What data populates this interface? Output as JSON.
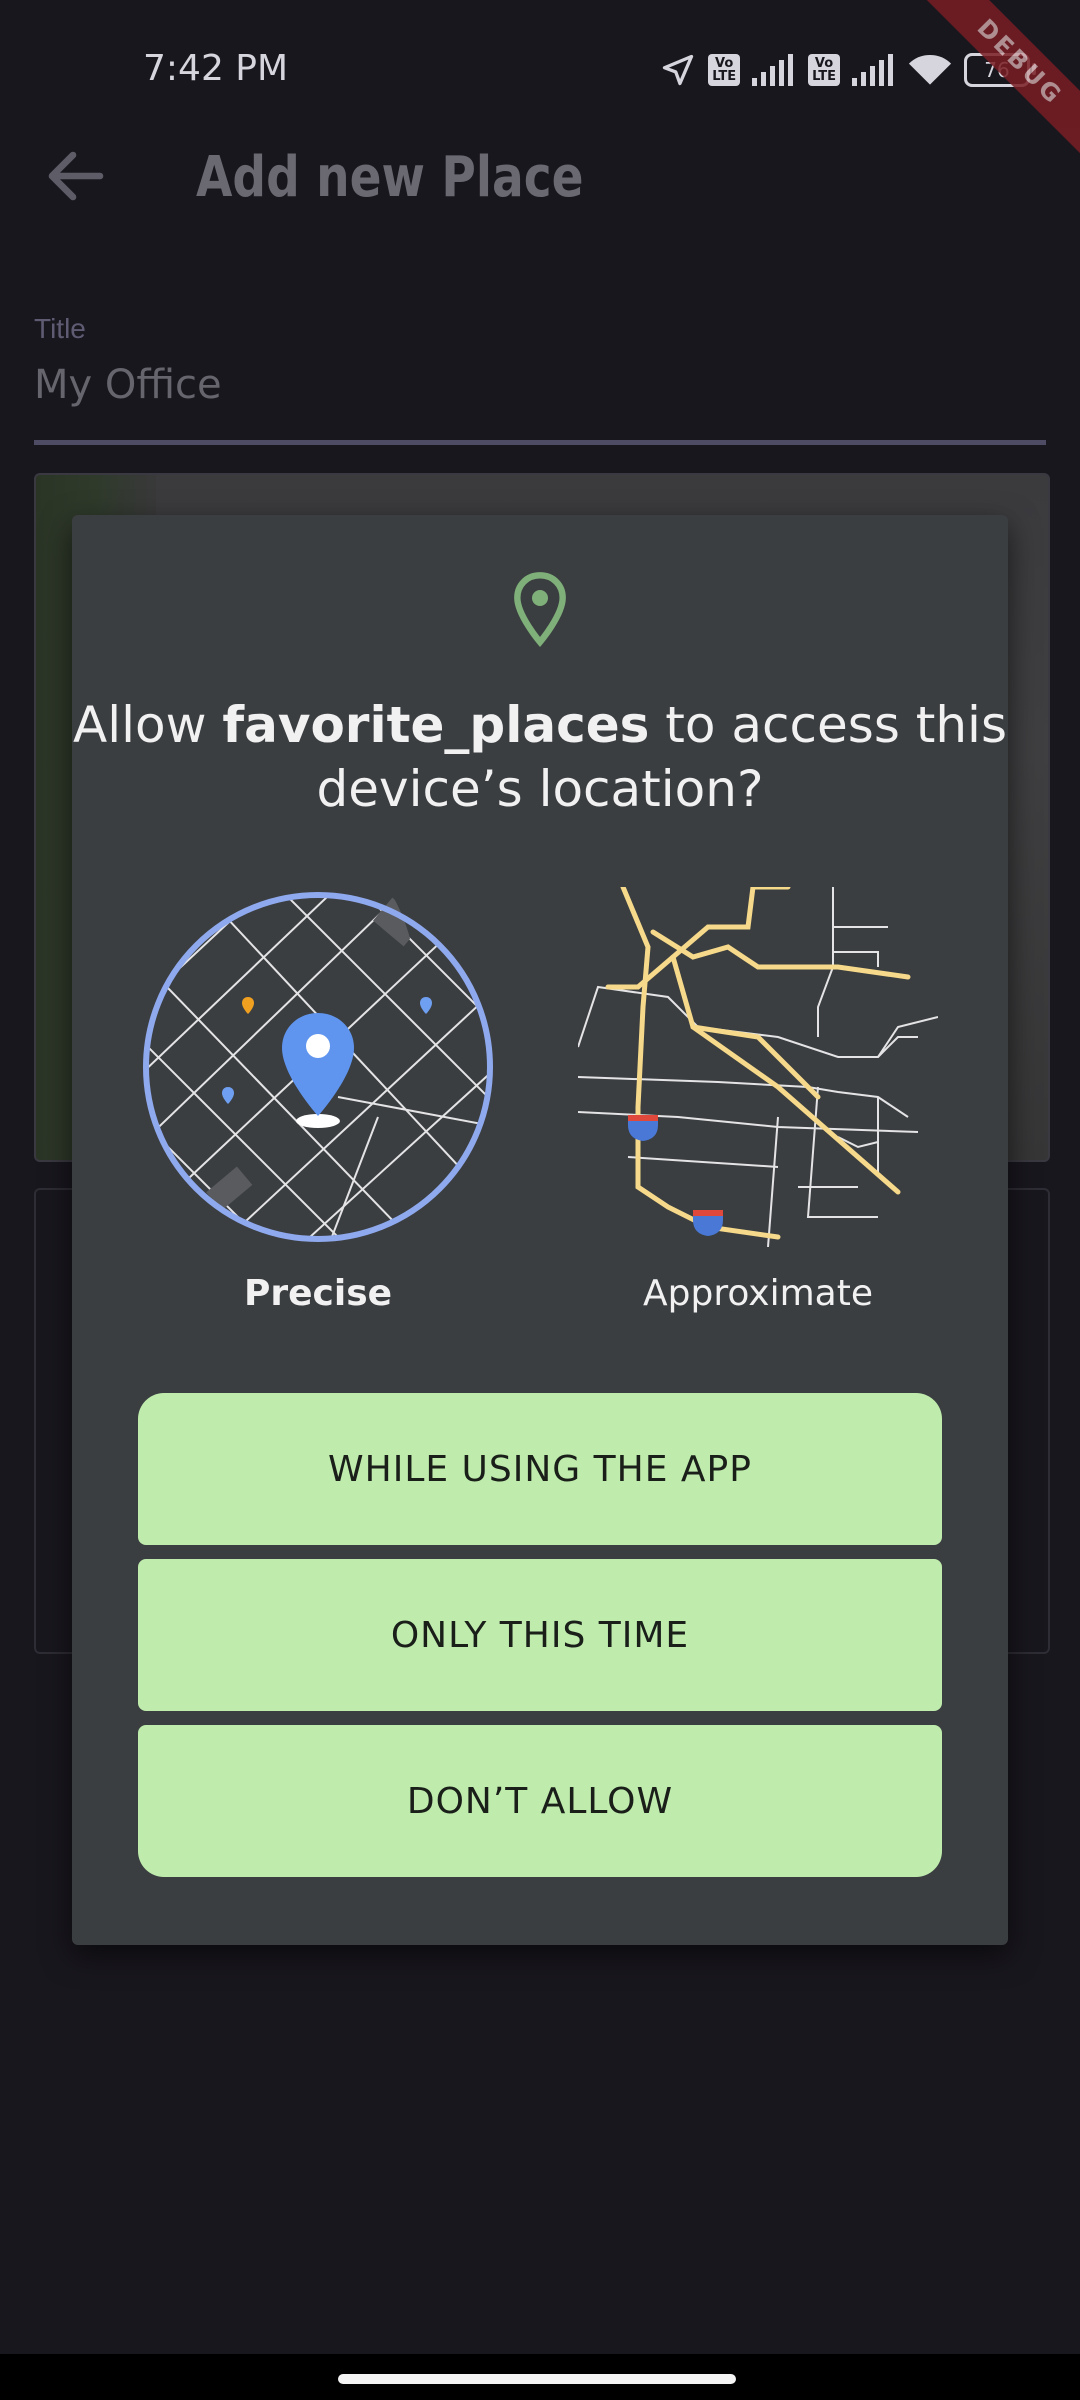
{
  "status_bar": {
    "time": "7:42 PM",
    "volte_1": "Vo\nLTE",
    "volte_2": "Vo\nLTE",
    "battery": "76",
    "debug_ribbon": "DEBUG"
  },
  "app_bar": {
    "title": "Add new Place",
    "back_icon": "arrow-left-icon"
  },
  "form": {
    "title_label": "Title",
    "title_value": "My Office"
  },
  "dialog": {
    "title_prefix": "Allow ",
    "app_name": "favorite_places",
    "title_suffix": " to access this device’s location?",
    "precise_label": "Precise",
    "approximate_label": "Approximate",
    "buttons": {
      "while_using": "WHILE USING THE APP",
      "only_this_time": "ONLY THIS TIME",
      "dont_allow": "DON’T ALLOW"
    },
    "colors": {
      "background": "#3b3e40",
      "button": "#bfecad",
      "pin": "#7fb07a",
      "precise_ring": "#8fa9ef",
      "roads": "#f6d98a"
    }
  }
}
